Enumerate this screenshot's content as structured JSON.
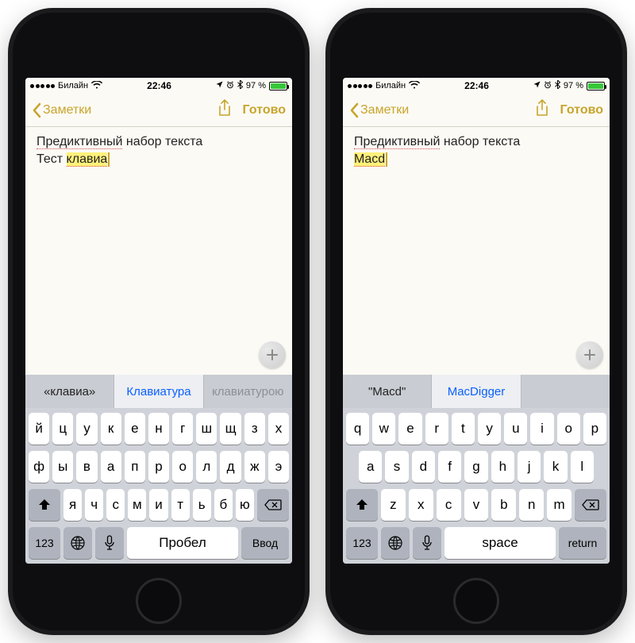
{
  "phones": [
    {
      "status": {
        "carrier": "Билайн",
        "time": "22:46",
        "battery_pct": "97 %"
      },
      "nav": {
        "back": "Заметки",
        "done": "Готово"
      },
      "note": {
        "line1_a": "Предиктивный",
        "line1_b": " набор текста",
        "line2_a": "Тест ",
        "line2_hl": "клавиа"
      },
      "predict": {
        "a": "«клавиа»",
        "b": "Клавиатура",
        "c": "клавиатурою"
      },
      "kb": {
        "r1": [
          "й",
          "ц",
          "у",
          "к",
          "е",
          "н",
          "г",
          "ш",
          "щ",
          "з",
          "х"
        ],
        "r2": [
          "ф",
          "ы",
          "в",
          "а",
          "п",
          "р",
          "о",
          "л",
          "д",
          "ж",
          "э"
        ],
        "r3": [
          "я",
          "ч",
          "с",
          "м",
          "и",
          "т",
          "ь",
          "б",
          "ю"
        ],
        "num": "123",
        "space": "Пробел",
        "enter": "Ввод"
      }
    },
    {
      "status": {
        "carrier": "Билайн",
        "time": "22:46",
        "battery_pct": "97 %"
      },
      "nav": {
        "back": "Заметки",
        "done": "Готово"
      },
      "note": {
        "line1_a": "Предиктивный",
        "line1_b": " набор текста",
        "line2_a": "",
        "line2_hl": "Macd"
      },
      "predict": {
        "a": "\"Macd\"",
        "b": "MacDigger",
        "c": ""
      },
      "kb": {
        "r1": [
          "q",
          "w",
          "e",
          "r",
          "t",
          "y",
          "u",
          "i",
          "o",
          "p"
        ],
        "r2": [
          "a",
          "s",
          "d",
          "f",
          "g",
          "h",
          "j",
          "k",
          "l"
        ],
        "r3": [
          "z",
          "x",
          "c",
          "v",
          "b",
          "n",
          "m"
        ],
        "num": "123",
        "space": "space",
        "enter": "return"
      }
    }
  ]
}
